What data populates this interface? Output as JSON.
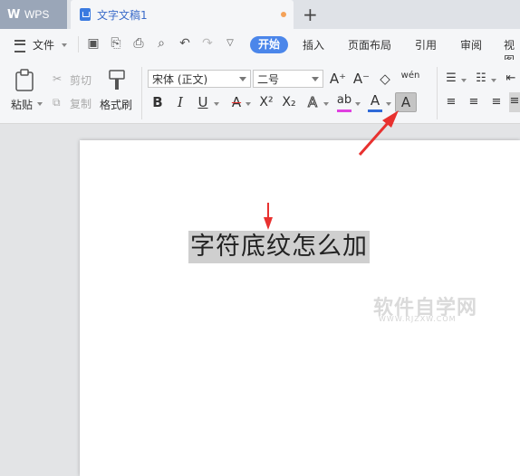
{
  "tabbar": {
    "app_name": "WPS",
    "doc_tab_title": "文字文稿1",
    "add_tab": "+"
  },
  "menubar": {
    "file_label": "文件",
    "tabs": [
      "开始",
      "插入",
      "页面布局",
      "引用",
      "审阅",
      "视图"
    ]
  },
  "ribbon": {
    "paste_label": "粘贴",
    "cut_label": "剪切",
    "copy_label": "复制",
    "format_painter_label": "格式刷",
    "font_name": "宋体 (正文)",
    "font_size": "二号",
    "grow_font": "A⁺",
    "shrink_font": "A⁻",
    "pinyin_glyph": "wén",
    "bold": "B",
    "italic": "I",
    "underline": "U",
    "strike": "A",
    "superscript": "X²",
    "subscript": "X₂",
    "text_effect": "A",
    "highlight": "ab",
    "font_color": "A",
    "char_shading": "A"
  },
  "document": {
    "text": "字符底纹怎么加",
    "watermark": "软件自学网",
    "watermark_url": "WWW.RJZXW.COM"
  },
  "colors": {
    "accent": "#4b86ea",
    "arrow": "#e8312f",
    "shading": "#cfcfcf",
    "highlight_bar": "#e040e0",
    "font_color_bar": "#2f6ad8"
  }
}
